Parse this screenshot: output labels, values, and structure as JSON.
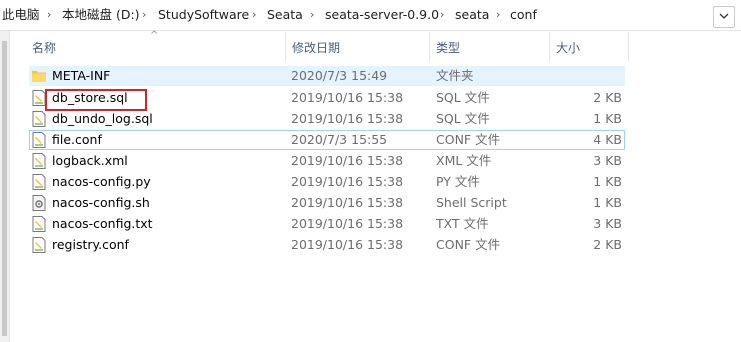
{
  "address_bar": {
    "crumbs": [
      "此电脑",
      "本地磁盘 (D:)",
      "StudySoftware",
      "Seata",
      "seata-server-0.9.0",
      "seata",
      "conf"
    ]
  },
  "columns": {
    "name": "名称",
    "date": "修改日期",
    "type": "类型",
    "size": "大小"
  },
  "files": [
    {
      "name": "META-INF",
      "date": "2020/7/3 15:49",
      "type": "文件夹",
      "size": "",
      "icon": "folder-icon"
    },
    {
      "name": "db_store.sql",
      "date": "2019/10/16 15:38",
      "type": "SQL 文件",
      "size": "2 KB",
      "icon": "file-icon"
    },
    {
      "name": "db_undo_log.sql",
      "date": "2019/10/16 15:38",
      "type": "SQL 文件",
      "size": "1 KB",
      "icon": "file-icon"
    },
    {
      "name": "file.conf",
      "date": "2020/7/3 15:55",
      "type": "CONF 文件",
      "size": "4 KB",
      "icon": "file-icon"
    },
    {
      "name": "logback.xml",
      "date": "2019/10/16 15:38",
      "type": "XML 文件",
      "size": "3 KB",
      "icon": "file-icon"
    },
    {
      "name": "nacos-config.py",
      "date": "2019/10/16 15:38",
      "type": "PY 文件",
      "size": "1 KB",
      "icon": "file-icon"
    },
    {
      "name": "nacos-config.sh",
      "date": "2019/10/16 15:38",
      "type": "Shell Script",
      "size": "1 KB",
      "icon": "script-icon"
    },
    {
      "name": "nacos-config.txt",
      "date": "2019/10/16 15:38",
      "type": "TXT 文件",
      "size": "3 KB",
      "icon": "file-icon"
    },
    {
      "name": "registry.conf",
      "date": "2019/10/16 15:38",
      "type": "CONF 文件",
      "size": "2 KB",
      "icon": "file-icon"
    }
  ],
  "colors": {
    "hover_row": "#e5f3ff",
    "focus_outline": "#99d1ff",
    "annotation_box": "#e02020"
  }
}
